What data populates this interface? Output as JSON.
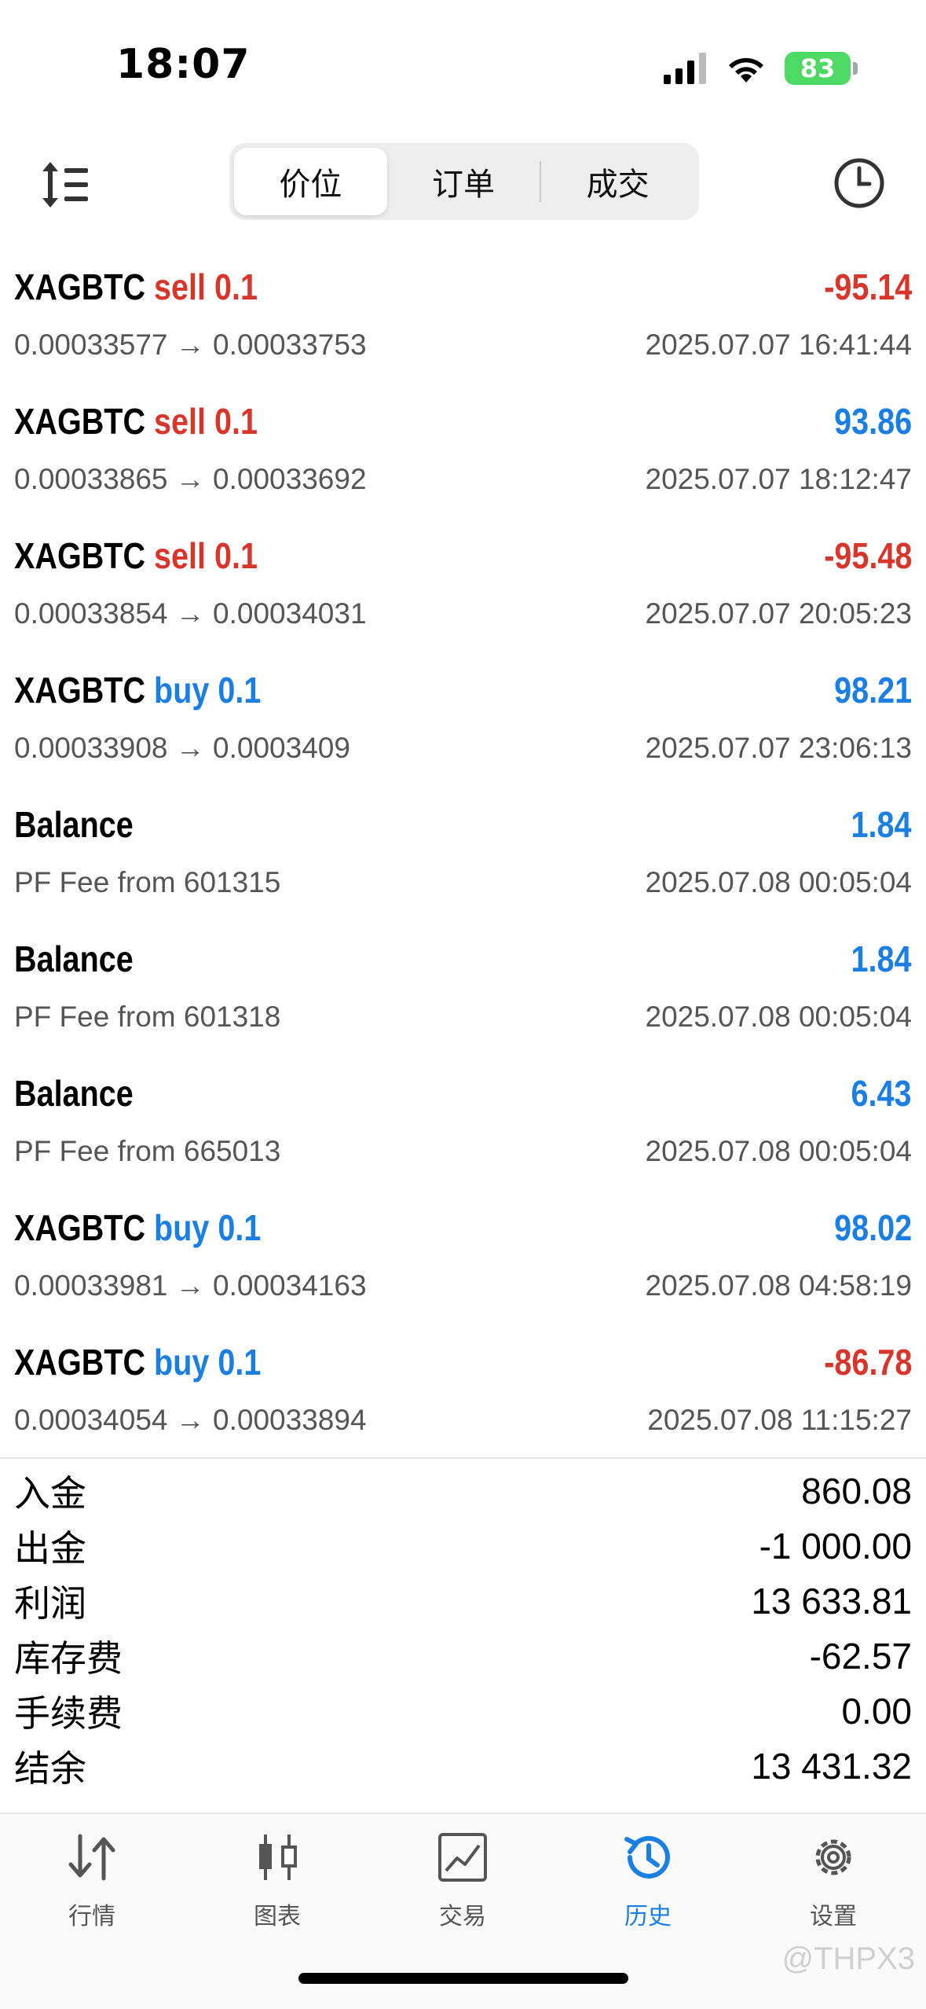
{
  "status_bar": {
    "time": "18:07",
    "battery": "83"
  },
  "segments": [
    "价位",
    "订单",
    "成交"
  ],
  "rows": [
    {
      "symbol": "XAGBTC",
      "side": "sell 0.1",
      "side_color": "red",
      "profit": "-95.14",
      "profit_color": "red",
      "prices": "0.00033577 → 0.00033753",
      "date": "2025.07.07 16:41:44"
    },
    {
      "symbol": "XAGBTC",
      "side": "sell 0.1",
      "side_color": "red",
      "profit": "93.86",
      "profit_color": "blue",
      "prices": "0.00033865 → 0.00033692",
      "date": "2025.07.07 18:12:47"
    },
    {
      "symbol": "XAGBTC",
      "side": "sell 0.1",
      "side_color": "red",
      "profit": "-95.48",
      "profit_color": "red",
      "prices": "0.00033854 → 0.00034031",
      "date": "2025.07.07 20:05:23"
    },
    {
      "symbol": "XAGBTC",
      "side": "buy 0.1",
      "side_color": "blue",
      "profit": "98.21",
      "profit_color": "blue",
      "prices": "0.00033908 → 0.0003409",
      "date": "2025.07.07 23:06:13"
    },
    {
      "symbol": "Balance",
      "side": "",
      "side_color": "",
      "profit": "1.84",
      "profit_color": "blue",
      "prices": "PF Fee from 601315",
      "date": "2025.07.08 00:05:04"
    },
    {
      "symbol": "Balance",
      "side": "",
      "side_color": "",
      "profit": "1.84",
      "profit_color": "blue",
      "prices": "PF Fee from 601318",
      "date": "2025.07.08 00:05:04"
    },
    {
      "symbol": "Balance",
      "side": "",
      "side_color": "",
      "profit": "6.43",
      "profit_color": "blue",
      "prices": "PF Fee from 665013",
      "date": "2025.07.08 00:05:04"
    },
    {
      "symbol": "XAGBTC",
      "side": "buy 0.1",
      "side_color": "blue",
      "profit": "98.02",
      "profit_color": "blue",
      "prices": "0.00033981 → 0.00034163",
      "date": "2025.07.08 04:58:19"
    },
    {
      "symbol": "XAGBTC",
      "side": "buy 0.1",
      "side_color": "blue",
      "profit": "-86.78",
      "profit_color": "red",
      "prices": "0.00034054 → 0.00033894",
      "date": "2025.07.08 11:15:27"
    }
  ],
  "summary": [
    {
      "label": "入金",
      "value": "860.08"
    },
    {
      "label": "出金",
      "value": "-1 000.00"
    },
    {
      "label": "利润",
      "value": "13 633.81"
    },
    {
      "label": "库存费",
      "value": "-62.57"
    },
    {
      "label": "手续费",
      "value": "0.00"
    },
    {
      "label": "结余",
      "value": "13 431.32"
    }
  ],
  "tabs": [
    {
      "label": "行情",
      "icon": "arrows-updown-icon",
      "active": false
    },
    {
      "label": "图表",
      "icon": "candlestick-icon",
      "active": false
    },
    {
      "label": "交易",
      "icon": "chart-line-icon",
      "active": false
    },
    {
      "label": "历史",
      "icon": "history-icon",
      "active": true
    },
    {
      "label": "设置",
      "icon": "gear-icon",
      "active": false
    }
  ],
  "colors": {
    "red": "#d9362b",
    "blue": "#1a7ee3"
  },
  "watermark": "@THPX3"
}
